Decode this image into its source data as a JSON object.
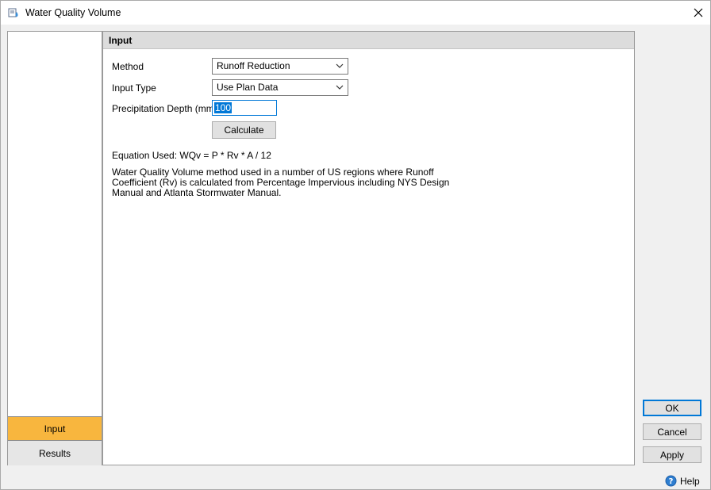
{
  "window": {
    "title": "Water Quality Volume"
  },
  "sidebar": {
    "tabs": [
      {
        "label": "Input"
      },
      {
        "label": "Results"
      }
    ]
  },
  "panel": {
    "header": "Input",
    "method": {
      "label": "Method",
      "value": "Runoff Reduction"
    },
    "input_type": {
      "label": "Input Type",
      "value": "Use Plan Data"
    },
    "precip": {
      "label": "Precipitation Depth (mm)",
      "value": "100"
    },
    "calculate_label": "Calculate",
    "equation": "Equation Used: WQv = P * Rv * A / 12",
    "description": "Water Quality Volume method used in a number of US regions where Runoff Coefficient (Rv) is calculated from Percentage Impervious including NYS Design Manual and Atlanta Stormwater Manual."
  },
  "buttons": {
    "ok": "OK",
    "cancel": "Cancel",
    "apply": "Apply"
  },
  "help": {
    "label": "Help",
    "icon": "help-icon"
  },
  "colors": {
    "active_tab": "#f8b63e",
    "selection": "#0078d7"
  }
}
